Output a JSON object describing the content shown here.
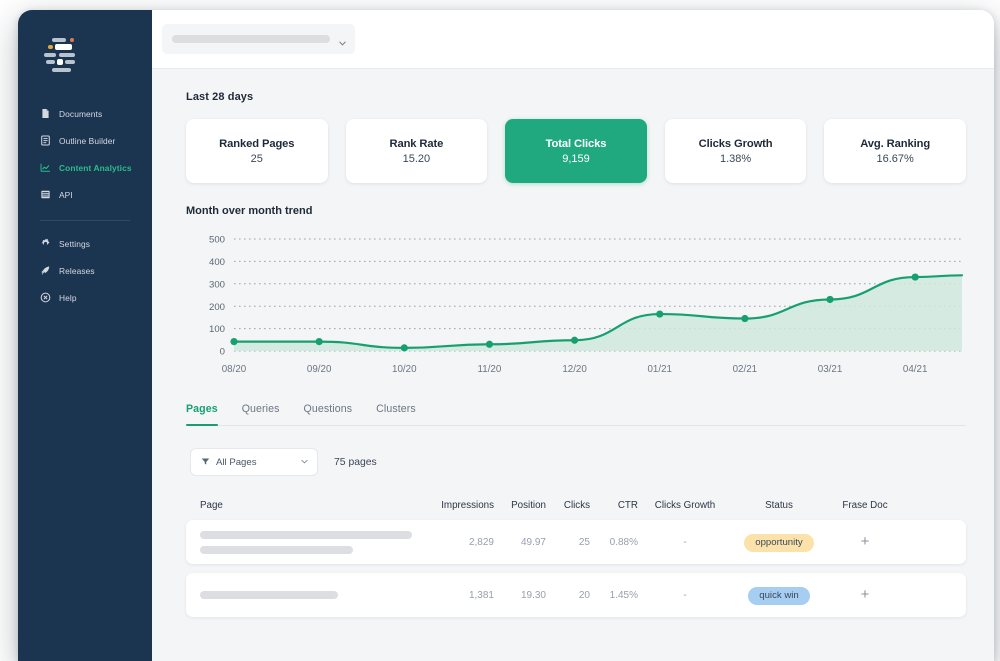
{
  "brand": {
    "logo_icon": "frase-logo-icon",
    "accent": "#20a97e",
    "sidebar_bg": "#1b3450"
  },
  "sidebar": {
    "items": [
      {
        "label": "Documents",
        "icon": "document-icon",
        "active": false
      },
      {
        "label": "Outline Builder",
        "icon": "outline-icon",
        "active": false
      },
      {
        "label": "Content Analytics",
        "icon": "chart-line-icon",
        "active": true
      },
      {
        "label": "API",
        "icon": "list-icon",
        "active": false
      }
    ],
    "footer_items": [
      {
        "label": "Settings",
        "icon": "gear-icon",
        "active": false
      },
      {
        "label": "Releases",
        "icon": "rocket-icon",
        "active": false
      },
      {
        "label": "Help",
        "icon": "help-circle-icon",
        "active": false
      }
    ]
  },
  "topbar": {
    "select_value": "",
    "select_placeholder": "",
    "chevron_icon": "chevron-down-icon"
  },
  "main": {
    "range_label": "Last 28 days",
    "cards": [
      {
        "title": "Ranked Pages",
        "value": "25",
        "selected": false
      },
      {
        "title": "Rank Rate",
        "value": "15.20",
        "selected": false
      },
      {
        "title": "Total Clicks",
        "value": "9,159",
        "selected": true
      },
      {
        "title": "Clicks Growth",
        "value": "1.38%",
        "selected": false
      },
      {
        "title": "Avg. Ranking",
        "value": "16.67%",
        "selected": false
      }
    ],
    "chart_title": "Month over month trend",
    "tabs": [
      {
        "label": "Pages",
        "active": true
      },
      {
        "label": "Queries",
        "active": false
      },
      {
        "label": "Questions",
        "active": false
      },
      {
        "label": "Clusters",
        "active": false
      }
    ],
    "filter": {
      "icon": "filter-icon",
      "label": "All Pages",
      "chevron_icon": "chevron-down-icon",
      "count_label": "75 pages"
    },
    "table": {
      "columns": [
        "Page",
        "Impressions",
        "Position",
        "Clicks",
        "CTR",
        "Clicks Growth",
        "Status",
        "Frase Doc"
      ],
      "rows": [
        {
          "page_skeleton_widths": [
            "100%",
            "72%"
          ],
          "impressions": "2,829",
          "position": "49.97",
          "clicks": "25",
          "ctr": "0.88%",
          "clicks_growth": "-",
          "status": "opportunity",
          "status_style": "opportunity",
          "frase_doc": "+"
        },
        {
          "page_skeleton_widths": [
            "65%"
          ],
          "impressions": "1,381",
          "position": "19.30",
          "clicks": "20",
          "ctr": "1.45%",
          "clicks_growth": "-",
          "status": "quick win",
          "status_style": "quickwin",
          "frase_doc": "+"
        }
      ]
    }
  },
  "chart_data": {
    "type": "area",
    "title": "Month over month trend",
    "xlabel": "",
    "ylabel": "",
    "grid": true,
    "legend": "none",
    "line_color": "#17a06f",
    "fill_color": "#cfe7dd",
    "ylim": [
      0,
      500
    ],
    "yticks": [
      0,
      100,
      200,
      300,
      400,
      500
    ],
    "categories": [
      "08/20",
      "09/20",
      "10/20",
      "11/20",
      "12/20",
      "01/21",
      "02/21",
      "03/21",
      "04/21"
    ],
    "values": [
      42,
      42,
      14,
      30,
      48,
      165,
      145,
      230,
      330
    ]
  }
}
